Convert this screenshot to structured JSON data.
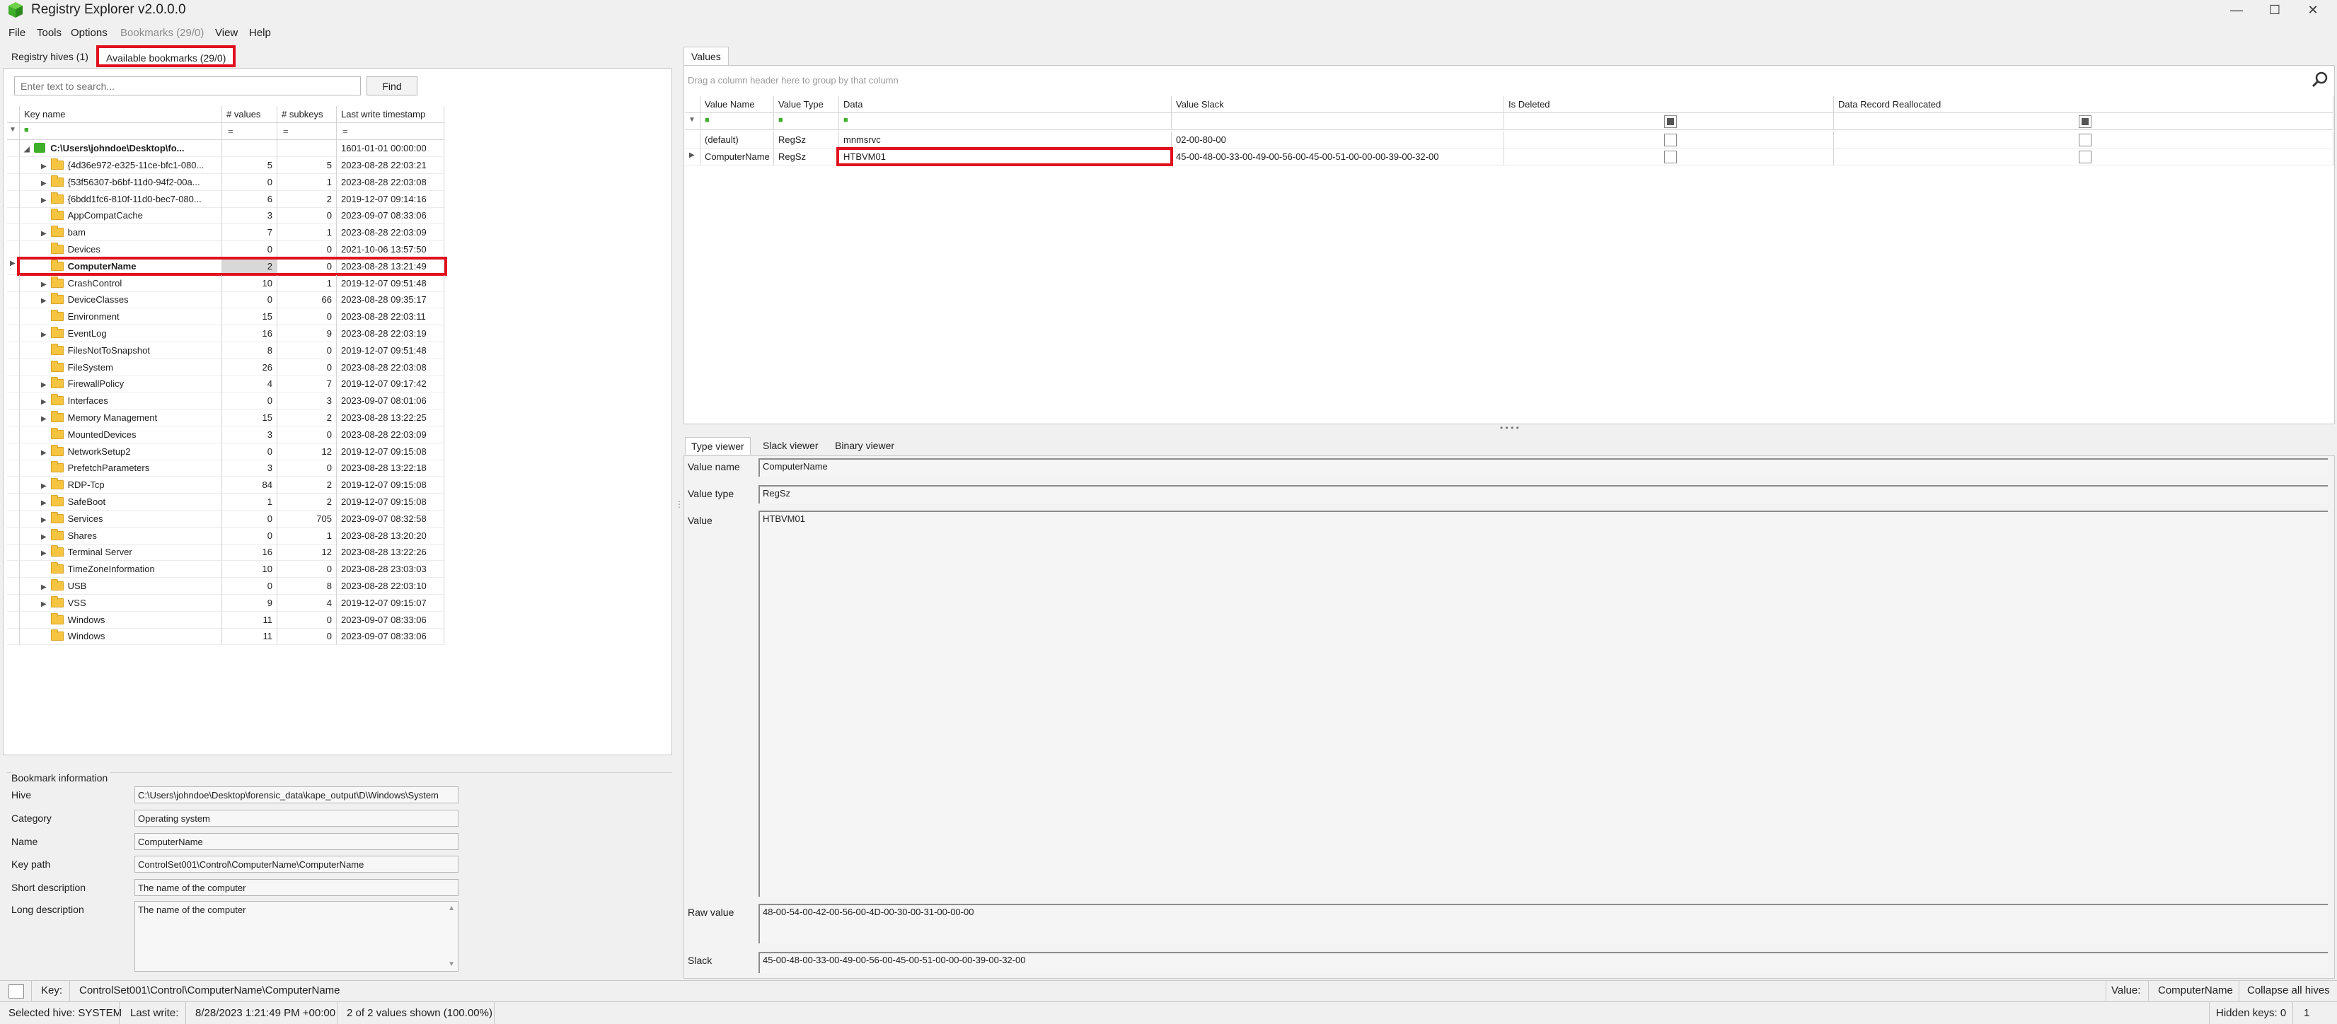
{
  "window": {
    "title": "Registry Explorer v2.0.0.0",
    "controls": {
      "minimize": "—",
      "maximize": "☐",
      "close": "✕"
    }
  },
  "menu": [
    {
      "label": "File",
      "disabled": false
    },
    {
      "label": "Tools",
      "disabled": false
    },
    {
      "label": "Options",
      "disabled": false
    },
    {
      "label": "Bookmarks (29/0)",
      "disabled": true
    },
    {
      "label": "View",
      "disabled": false
    },
    {
      "label": "Help",
      "disabled": false
    }
  ],
  "left_tabs": [
    {
      "label": "Registry hives (1)",
      "active": false
    },
    {
      "label": "Available bookmarks (29/0)",
      "active": true
    }
  ],
  "search": {
    "placeholder": "Enter text to search...",
    "find_label": "Find"
  },
  "key_grid": {
    "columns": [
      "Key name",
      "# values",
      "# subkeys",
      "Last write timestamp"
    ],
    "filter_symbols": [
      "=",
      "=",
      "="
    ],
    "root": {
      "name": "C:\\Users\\johndoe\\Desktop\\fo...",
      "timestamp": "1601-01-01 00:00:00"
    },
    "rows": [
      {
        "name": "{4d36e972-e325-11ce-bfc1-080...",
        "values": "5",
        "subkeys": "5",
        "ts": "2023-08-28 22:03:21",
        "expandable": true
      },
      {
        "name": "{53f56307-b6bf-11d0-94f2-00a...",
        "values": "0",
        "subkeys": "1",
        "ts": "2023-08-28 22:03:08",
        "expandable": true
      },
      {
        "name": "{6bdd1fc6-810f-11d0-bec7-080...",
        "values": "6",
        "subkeys": "2",
        "ts": "2019-12-07 09:14:16",
        "expandable": true
      },
      {
        "name": "AppCompatCache",
        "values": "3",
        "subkeys": "0",
        "ts": "2023-09-07 08:33:06",
        "expandable": false
      },
      {
        "name": "bam",
        "values": "7",
        "subkeys": "1",
        "ts": "2023-08-28 22:03:09",
        "expandable": true
      },
      {
        "name": "Devices",
        "values": "0",
        "subkeys": "0",
        "ts": "2021-10-06 13:57:50",
        "expandable": false
      },
      {
        "name": "ComputerName",
        "values": "2",
        "subkeys": "0",
        "ts": "2023-08-28 13:21:49",
        "expandable": false,
        "selected": true
      },
      {
        "name": "CrashControl",
        "values": "10",
        "subkeys": "1",
        "ts": "2019-12-07 09:51:48",
        "expandable": true
      },
      {
        "name": "DeviceClasses",
        "values": "0",
        "subkeys": "66",
        "ts": "2023-08-28 09:35:17",
        "expandable": true
      },
      {
        "name": "Environment",
        "values": "15",
        "subkeys": "0",
        "ts": "2023-08-28 22:03:11",
        "expandable": false
      },
      {
        "name": "EventLog",
        "values": "16",
        "subkeys": "9",
        "ts": "2023-08-28 22:03:19",
        "expandable": true
      },
      {
        "name": "FilesNotToSnapshot",
        "values": "8",
        "subkeys": "0",
        "ts": "2019-12-07 09:51:48",
        "expandable": false
      },
      {
        "name": "FileSystem",
        "values": "26",
        "subkeys": "0",
        "ts": "2023-08-28 22:03:08",
        "expandable": false
      },
      {
        "name": "FirewallPolicy",
        "values": "4",
        "subkeys": "7",
        "ts": "2019-12-07 09:17:42",
        "expandable": true
      },
      {
        "name": "Interfaces",
        "values": "0",
        "subkeys": "3",
        "ts": "2023-09-07 08:01:06",
        "expandable": true
      },
      {
        "name": "Memory Management",
        "values": "15",
        "subkeys": "2",
        "ts": "2023-08-28 13:22:25",
        "expandable": true
      },
      {
        "name": "MountedDevices",
        "values": "3",
        "subkeys": "0",
        "ts": "2023-08-28 22:03:09",
        "expandable": false
      },
      {
        "name": "NetworkSetup2",
        "values": "0",
        "subkeys": "12",
        "ts": "2019-12-07 09:15:08",
        "expandable": true
      },
      {
        "name": "PrefetchParameters",
        "values": "3",
        "subkeys": "0",
        "ts": "2023-08-28 13:22:18",
        "expandable": false
      },
      {
        "name": "RDP-Tcp",
        "values": "84",
        "subkeys": "2",
        "ts": "2019-12-07 09:15:08",
        "expandable": true
      },
      {
        "name": "SafeBoot",
        "values": "1",
        "subkeys": "2",
        "ts": "2019-12-07 09:15:08",
        "expandable": true
      },
      {
        "name": "Services",
        "values": "0",
        "subkeys": "705",
        "ts": "2023-09-07 08:32:58",
        "expandable": true
      },
      {
        "name": "Shares",
        "values": "0",
        "subkeys": "1",
        "ts": "2023-08-28 13:20:20",
        "expandable": true
      },
      {
        "name": "Terminal Server",
        "values": "16",
        "subkeys": "12",
        "ts": "2023-08-28 13:22:26",
        "expandable": true
      },
      {
        "name": "TimeZoneInformation",
        "values": "10",
        "subkeys": "0",
        "ts": "2023-08-28 23:03:03",
        "expandable": false
      },
      {
        "name": "USB",
        "values": "0",
        "subkeys": "8",
        "ts": "2023-08-28 22:03:10",
        "expandable": true
      },
      {
        "name": "VSS",
        "values": "9",
        "subkeys": "4",
        "ts": "2019-12-07 09:15:07",
        "expandable": true
      },
      {
        "name": "Windows",
        "values": "11",
        "subkeys": "0",
        "ts": "2023-09-07 08:33:06",
        "expandable": false
      },
      {
        "name": "Windows",
        "values": "11",
        "subkeys": "0",
        "ts": "2023-09-07 08:33:06",
        "expandable": false
      }
    ]
  },
  "bookmark_info": {
    "group_title": "Bookmark information",
    "fields": [
      {
        "label": "Hive",
        "value": "C:\\Users\\johndoe\\Desktop\\forensic_data\\kape_output\\D\\Windows\\System"
      },
      {
        "label": "Category",
        "value": "Operating system"
      },
      {
        "label": "Name",
        "value": "ComputerName"
      },
      {
        "label": "Key path",
        "value": "ControlSet001\\Control\\ComputerName\\ComputerName"
      },
      {
        "label": "Short description",
        "value": "The name of the computer"
      }
    ],
    "long_description_label": "Long description",
    "long_description": "The name of the computer"
  },
  "values_pane": {
    "tab_label": "Values",
    "group_hint": "Drag a column header here to group by that column",
    "columns": [
      "Value Name",
      "Value Type",
      "Data",
      "Value Slack",
      "Is Deleted",
      "Data Record Reallocated"
    ],
    "rows": [
      {
        "name": "(default)",
        "type": "RegSz",
        "data": "mnmsrvc",
        "slack": "02-00-80-00",
        "deleted": false,
        "reallocated": false
      },
      {
        "name": "ComputerName",
        "type": "RegSz",
        "data": "HTBVM01",
        "slack": "45-00-48-00-33-00-49-00-56-00-45-00-51-00-00-00-39-00-32-00",
        "deleted": false,
        "reallocated": false,
        "selected": true
      }
    ]
  },
  "viewer": {
    "tabs": [
      "Type viewer",
      "Slack viewer",
      "Binary viewer"
    ],
    "value_name_label": "Value name",
    "value_name": "ComputerName",
    "value_type_label": "Value type",
    "value_type": "RegSz",
    "value_label": "Value",
    "value": "HTBVM01",
    "raw_value_label": "Raw value",
    "raw_value": "48-00-54-00-42-00-56-00-4D-00-30-00-31-00-00-00",
    "slack_label": "Slack",
    "slack": "45-00-48-00-33-00-49-00-56-00-45-00-51-00-00-00-39-00-32-00"
  },
  "status": {
    "key_label": "Key:",
    "key_value": "ControlSet001\\Control\\ComputerName\\ComputerName",
    "value_label": "Value:",
    "value_value": "ComputerName",
    "collapse_label": "Collapse all hives",
    "selected_hive": "Selected hive: SYSTEM",
    "last_write_label": "Last write:",
    "last_write": "8/28/2023 1:21:49 PM +00:00",
    "values_shown": "2 of 2 values shown (100.00%)",
    "hidden_keys": "Hidden keys: 0",
    "count": "1"
  },
  "colors": {
    "highlight_red": "#e0101e",
    "folder_yellow": "#f5c441",
    "hive_green": "#3fae2a"
  }
}
